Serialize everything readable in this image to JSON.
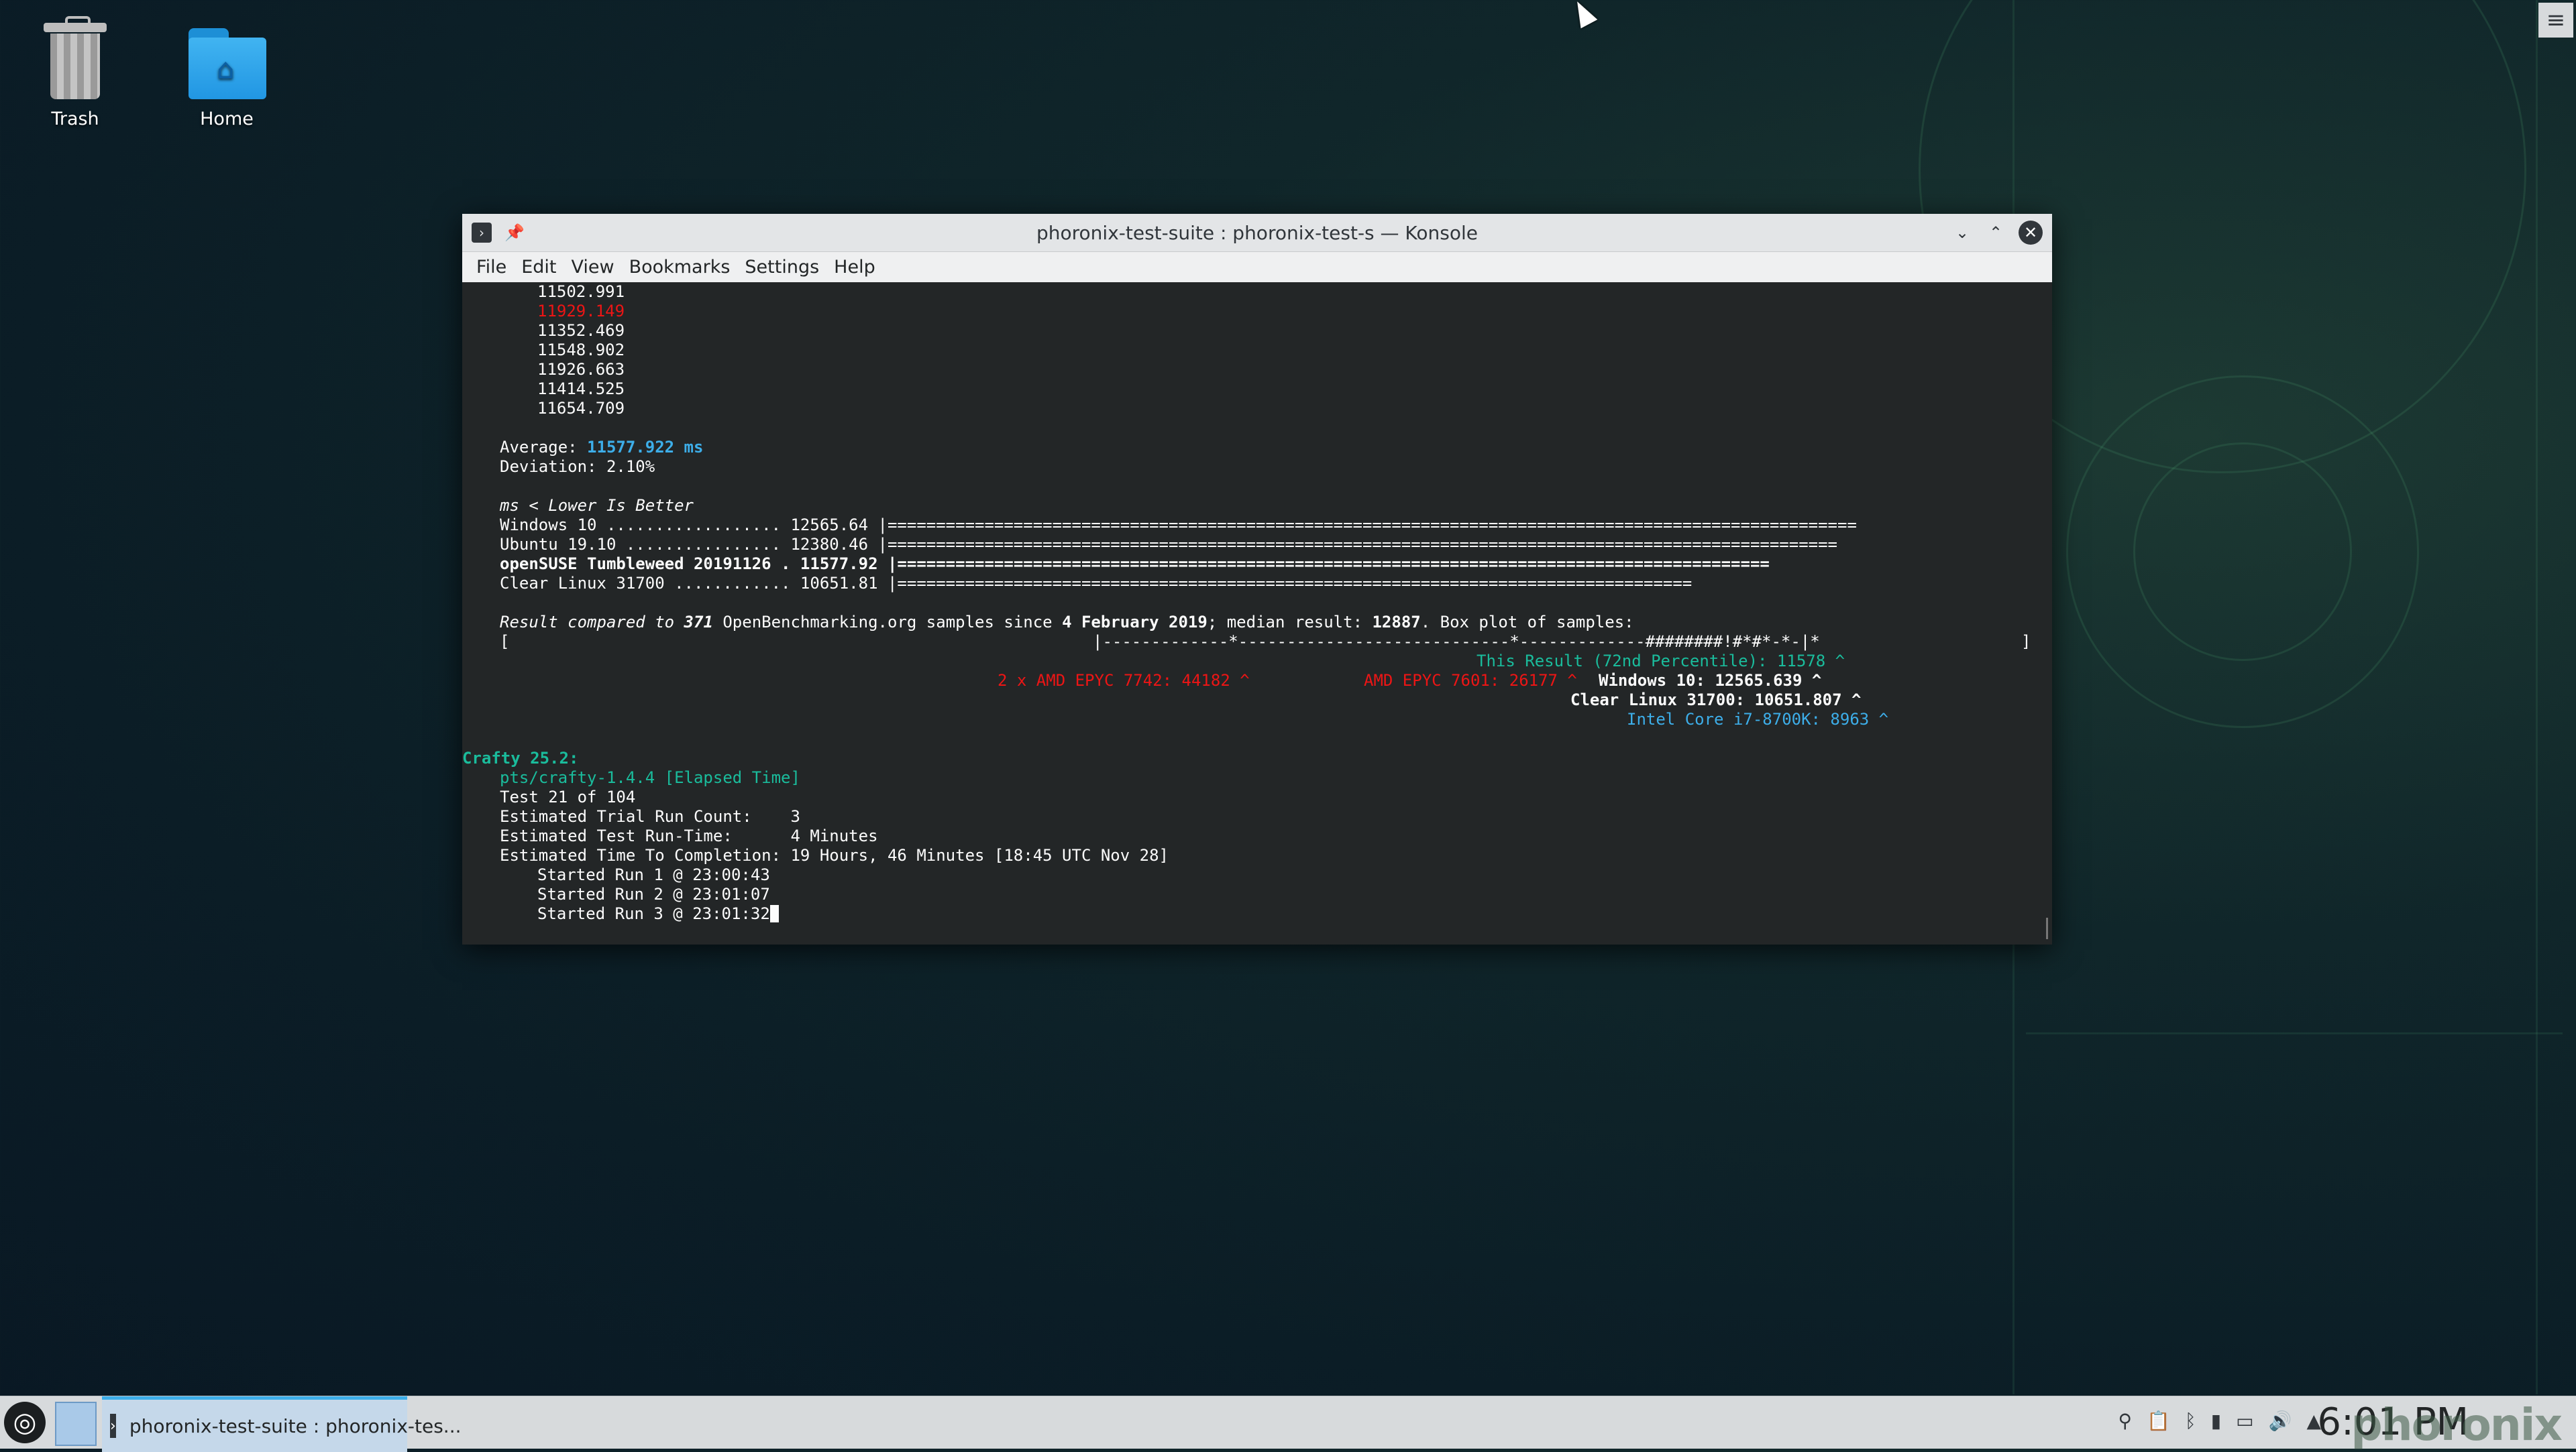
{
  "desktop": {
    "icons": [
      {
        "label": "Trash"
      },
      {
        "label": "Home"
      }
    ]
  },
  "window": {
    "title": "phoronix-test-suite : phoronix-test-s — Konsole",
    "menu": [
      "File",
      "Edit",
      "View",
      "Bookmarks",
      "Settings",
      "Help"
    ]
  },
  "terminal": {
    "runs": [
      "11502.991",
      "11929.149",
      "11352.469",
      "11548.902",
      "11926.663",
      "11414.525",
      "11654.709"
    ],
    "average_label": "Average: ",
    "average_value": "11577.922 ms",
    "deviation": "Deviation: 2.10%",
    "lower_better": "ms < Lower Is Better",
    "bars": [
      {
        "label": "Windows 10 .................. 12565.64 |",
        "bar": "===================================================================================================="
      },
      {
        "label": "Ubuntu 19.10 ................ 12380.46 |",
        "bar": "=================================================================================================="
      },
      {
        "label": "openSUSE Tumbleweed 20191126 . 11577.92 |",
        "bar": "=========================================================================================="
      },
      {
        "label": "Clear Linux 31700 ............ 10651.81 |",
        "bar": "=================================================================================="
      }
    ],
    "compare_p1": "Result compared to ",
    "compare_count": "371",
    "compare_p2": " OpenBenchmarking.org samples since ",
    "compare_date": "4 February 2019",
    "compare_p3": "; median result: ",
    "compare_median": "12887",
    "compare_p4": ". Box plot of samples:",
    "box_open": "[",
    "box_plot": "|-------------*----------------------------*-------------########!#*#*-*-|*",
    "box_close": "]",
    "this_result": "This Result (72nd Percentile): 11578 ^",
    "epyc_7742": "2 x AMD EPYC 7742: 44182 ^",
    "epyc_7601": "AMD EPYC 7601: 26177 ^",
    "win10_ref": "Windows 10: 12565.639 ^",
    "clear_ref": "Clear Linux 31700: 10651.807 ^",
    "intel_ref": "Intel Core i7-8700K: 8963 ^",
    "crafty_header": "Crafty 25.2:",
    "crafty_test": "pts/crafty-1.4.4 [Elapsed Time]",
    "test_num": "Test 21 of 104",
    "trial_count": "Estimated Trial Run Count:    3",
    "run_time": "Estimated Test Run-Time:      4 Minutes",
    "completion": "Estimated Time To Completion: 19 Hours, 46 Minutes [18:45 UTC Nov 28]",
    "started": [
      "Started Run 1 @ 23:00:43",
      "Started Run 2 @ 23:01:07",
      "Started Run 3 @ 23:01:32"
    ]
  },
  "taskbar": {
    "task_label": "phoronix-test-suite : phoronix-tes...",
    "clock": "6:01 PM",
    "watermark": "phoronix"
  },
  "colors": {
    "accent": "#3daee9",
    "error": "#ed1515",
    "teal": "#1abc9c"
  }
}
